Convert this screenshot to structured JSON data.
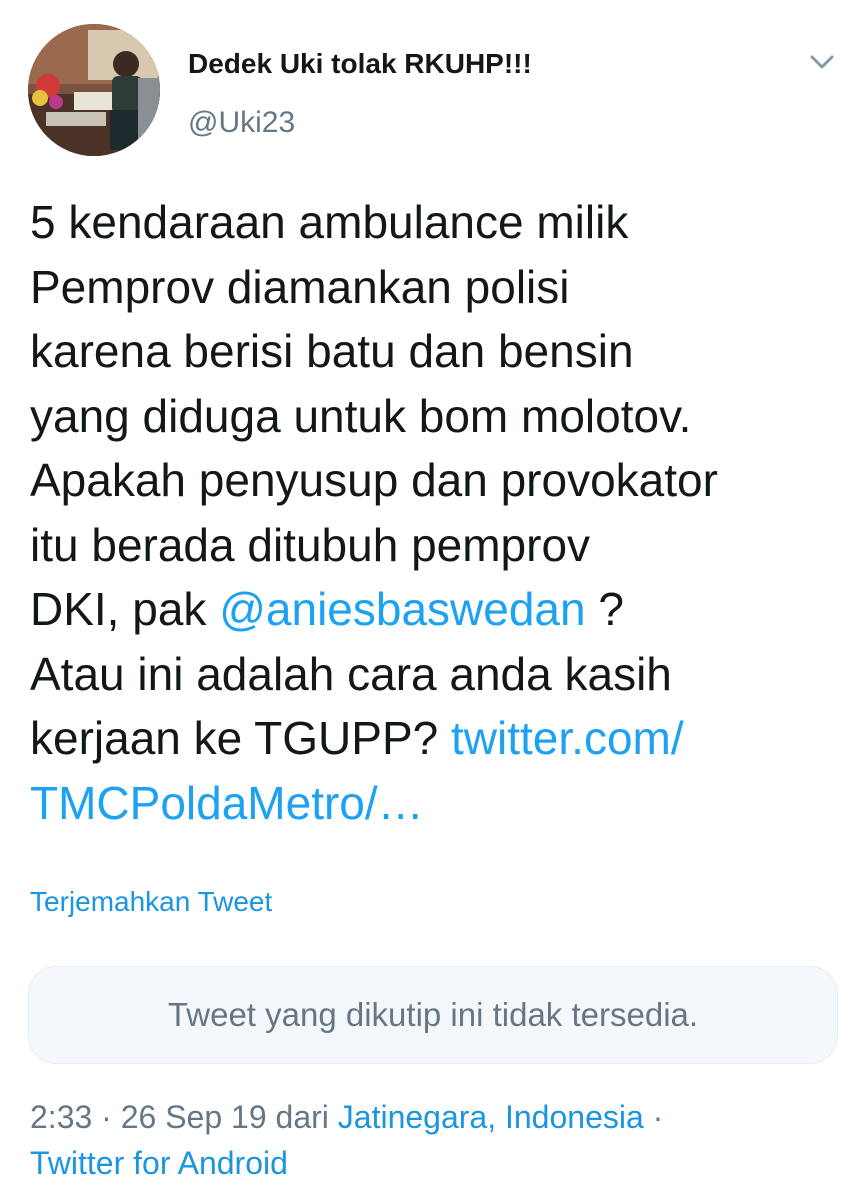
{
  "author": {
    "display_name": "Dedek Uki tolak RKUHP!!!",
    "handle": "@Uki23",
    "avatar_icon": "profile-photo"
  },
  "menu": {
    "icon": "chevron-down-icon"
  },
  "tweet": {
    "line1": "5 kendaraan ambulance milik",
    "line2": "Pemprov diamankan polisi",
    "line3": "karena berisi batu dan bensin",
    "line4": "yang diduga untuk bom molotov.",
    "line5": "Apakah penyusup dan provokator",
    "line6": "itu berada ditubuh pemprov",
    "line7_pre": "DKI, pak ",
    "mention": "@aniesbaswedan",
    "line7_post": " ?",
    "line8": "Atau ini adalah cara anda kasih",
    "line9_pre": "kerjaan ke TGUPP? ",
    "link_part1": "twitter.com/",
    "link_part2": "TMCPoldaMetro/…"
  },
  "translate_label": "Terjemahkan Tweet",
  "quoted_tweet": {
    "unavailable_text": "Tweet yang dikutip ini tidak tersedia."
  },
  "meta": {
    "time": "2:33",
    "separator1": " · ",
    "date": "26 Sep 19",
    "from_word": " dari ",
    "location": "Jatinegara, Indonesia",
    "separator2": " ·",
    "client": "Twitter for Android"
  },
  "colors": {
    "link": "#1da1f2",
    "secondary_text": "#657786",
    "primary_text": "#14171a",
    "quote_bg": "#f5f8fa"
  }
}
